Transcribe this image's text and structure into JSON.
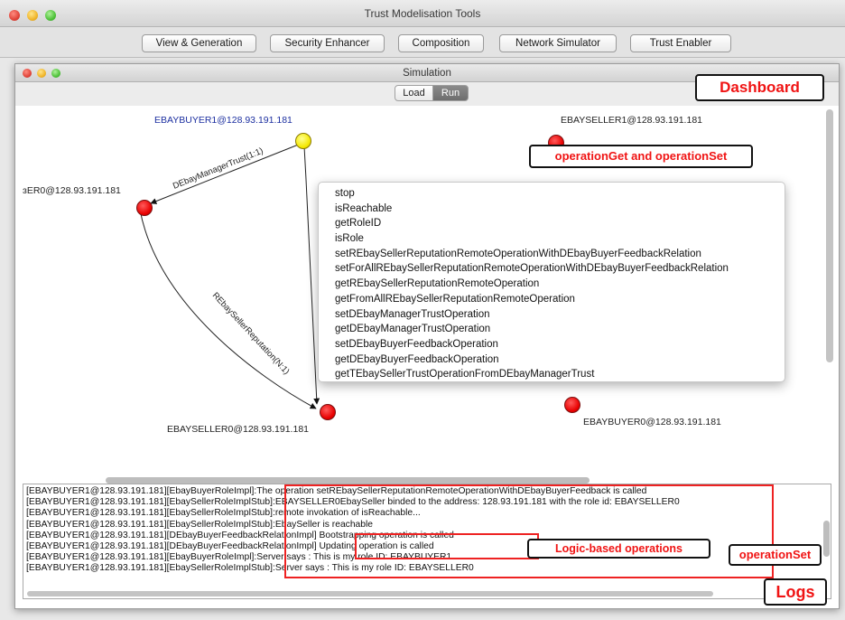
{
  "app": {
    "title": "Trust Modelisation Tools"
  },
  "toolbar": {
    "buttons": [
      "View & Generation",
      "Security Enhancer",
      "Composition",
      "Network Simulator",
      "Trust Enabler"
    ]
  },
  "simulation": {
    "title": "Simulation",
    "segments": {
      "load": "Load",
      "run": "Run"
    }
  },
  "graph": {
    "nodes": {
      "buyer1": "EBAYBUYER1@128.93.191.181",
      "seller1": "EBAYSELLER1@128.93.191.181",
      "manager0": "ɜER0@128.93.191.181",
      "seller0": "EBAYSELLER0@128.93.191.181",
      "buyer0": "EBAYBUYER0@128.93.191.181"
    },
    "edges": {
      "manager_trust": "DEbayManagerTrust(1:1)",
      "seller_reputation": "REbaySellerReputation(N:1)"
    }
  },
  "popup": {
    "items": [
      "stop",
      "isReachable",
      "getRoleID",
      "isRole",
      "setREbaySellerReputationRemoteOperationWithDEbayBuyerFeedbackRelation",
      "setForAllREbaySellerReputationRemoteOperationWithDEbayBuyerFeedbackRelation",
      "getREbaySellerReputationRemoteOperation",
      "getFromAllREbaySellerReputationRemoteOperation",
      "setDEbayManagerTrustOperation",
      "getDEbayManagerTrustOperation",
      "setDEbayBuyerFeedbackOperation",
      "getDEbayBuyerFeedbackOperation",
      "getTEbaySellerTrustOperationFromDEbayManagerTrust"
    ]
  },
  "logs": {
    "lines": [
      "[EBAYBUYER1@128.93.191.181][EbayBuyerRoleImpl]:The operation setREbaySellerReputationRemoteOperationWithDEbayBuyerFeedback is called",
      "[EBAYBUYER1@128.93.191.181][EbaySellerRoleImplStub]:EBAYSELLER0EbaySeller binded to the address: 128.93.191.181 with the role id: EBAYSELLER0",
      "[EBAYBUYER1@128.93.191.181][EbaySellerRoleImplStub]:remote invokation of isReachable...",
      "[EBAYBUYER1@128.93.191.181][EbaySellerRoleImplStub]:EbaySeller is reachable",
      "[EBAYBUYER1@128.93.191.181][DEbayBuyerFeedbackRelationImpl] Bootstrapping operation is called",
      "[EBAYBUYER1@128.93.191.181][DEbayBuyerFeedbackRelationImpl] Updating operation is called",
      "[EBAYBUYER1@128.93.191.181][EbayBuyerRoleImpl]:Server says : This is my role ID: EBAYBUYER1",
      "[EBAYBUYER1@128.93.191.181][EbaySellerRoleImplStub]:Server says : This is my role ID: EBAYSELLER0"
    ]
  },
  "callouts": {
    "dashboard": "Dashboard",
    "operation_get_set": "operationGet and operationSet",
    "operation_set": "operationSet",
    "logic_based": "Logic-based operations",
    "logs": "Logs"
  },
  "colors": {
    "callout_text": "#f01414",
    "node_red": "#e80000",
    "node_yellow": "#f4e800"
  }
}
